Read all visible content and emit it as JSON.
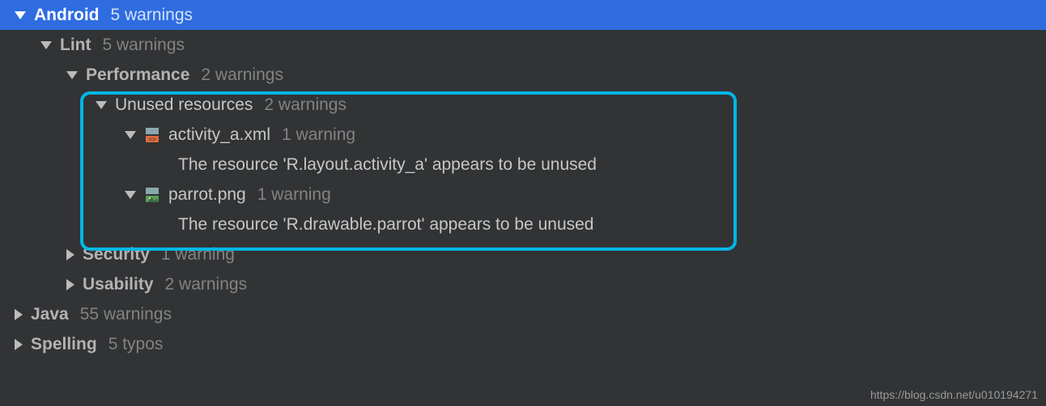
{
  "tree": {
    "android": {
      "label": "Android",
      "count": "5 warnings"
    },
    "lint": {
      "label": "Lint",
      "count": "5 warnings"
    },
    "performance": {
      "label": "Performance",
      "count": "2 warnings"
    },
    "unused": {
      "label": "Unused resources",
      "count": "2 warnings"
    },
    "file1": {
      "name": "activity_a.xml",
      "count": "1 warning",
      "msg": "The resource 'R.layout.activity_a' appears to be unused"
    },
    "file2": {
      "name": "parrot.png",
      "count": "1 warning",
      "msg": "The resource 'R.drawable.parrot' appears to be unused"
    },
    "security": {
      "label": "Security",
      "count": "1 warning"
    },
    "usability": {
      "label": "Usability",
      "count": "2 warnings"
    },
    "java": {
      "label": "Java",
      "count": "55 warnings"
    },
    "spelling": {
      "label": "Spelling",
      "count": "5 typos"
    }
  },
  "watermark": "https://blog.csdn.net/u010194271"
}
